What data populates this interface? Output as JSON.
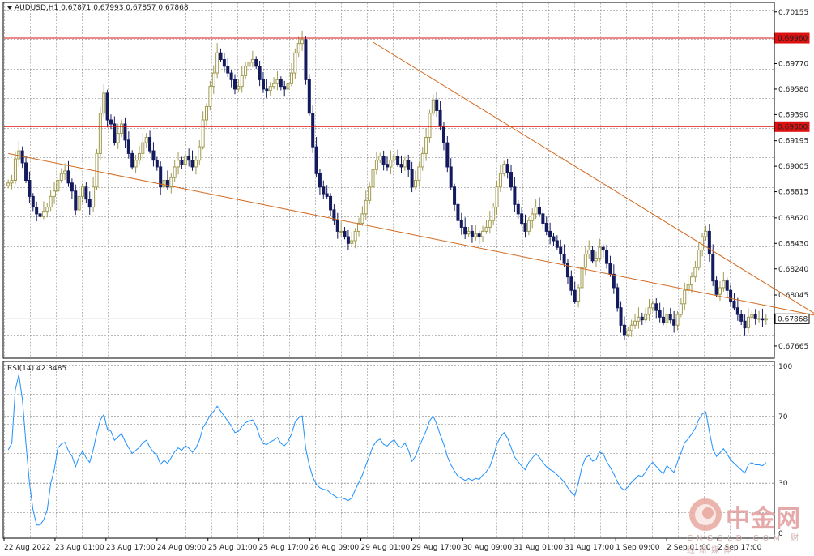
{
  "header": {
    "symbol_line": "AUDUSD,H1  0.67871 0.67993 0.67857 0.67868",
    "menu_icon": "triangle-down-icon"
  },
  "rsi_header": "RSI(14) 42.3485",
  "watermark": {
    "brand": "中金网",
    "url": "CNGOLD.COM",
    "tagline": "财经新媒体"
  },
  "colors": {
    "background": "#ffffff",
    "grid": "#7a7a7a",
    "bull_candle": "#a09a4f",
    "bear_candle": "#141a5e",
    "trend_line": "#d2691e",
    "resistance_line": "#dd1111",
    "current_price_line": "#7a8fb0",
    "rsi_line": "#1e90ff"
  },
  "chart_data": [
    {
      "type": "candlestick",
      "symbol": "AUDUSD",
      "timeframe": "H1",
      "ohlc_header": {
        "open": 0.67871,
        "high": 0.67993,
        "low": 0.67857,
        "close": 0.67868
      },
      "ylim": [
        0.6758,
        0.7022
      ],
      "yticks": [
        "0.70155",
        "0.69770",
        "0.69580",
        "0.69390",
        "0.69195",
        "0.69005",
        "0.68815",
        "0.68620",
        "0.68430",
        "0.68240",
        "0.68045",
        "0.67665"
      ],
      "xticks": [
        "22 Aug 2022",
        "23 Aug 01:00",
        "23 Aug 17:00",
        "24 Aug 09:00",
        "25 Aug 01:00",
        "25 Aug 17:00",
        "26 Aug 09:00",
        "29 Aug 01:00",
        "29 Aug 17:00",
        "30 Aug 09:00",
        "31 Aug 01:00",
        "31 Aug 17:00",
        "1 Sep 09:00",
        "2 Sep 01:00",
        "2 Sep 17:00"
      ],
      "price_levels": [
        {
          "label": "0.69960",
          "value": 0.6996,
          "kind": "horizontal"
        },
        {
          "label": "0.69300",
          "value": 0.693,
          "kind": "horizontal"
        },
        {
          "label": "0.67868",
          "value": 0.67868,
          "kind": "current"
        }
      ],
      "trendlines": [
        {
          "from": [
            0,
            0.691
          ],
          "to": [
            230,
            0.67882
          ]
        },
        {
          "from": [
            103,
            0.6993
          ],
          "to": [
            230,
            0.6787
          ]
        }
      ],
      "closes": [
        0.6888,
        0.689,
        0.6906,
        0.6912,
        0.6903,
        0.689,
        0.6878,
        0.687,
        0.6865,
        0.6863,
        0.6867,
        0.687,
        0.6878,
        0.6882,
        0.689,
        0.6895,
        0.6897,
        0.6888,
        0.6882,
        0.6868,
        0.6878,
        0.6885,
        0.6876,
        0.687,
        0.6885,
        0.691,
        0.694,
        0.6955,
        0.6935,
        0.6932,
        0.6918,
        0.6925,
        0.6932,
        0.692,
        0.691,
        0.69,
        0.6905,
        0.691,
        0.6918,
        0.6922,
        0.6912,
        0.6905,
        0.69,
        0.6885,
        0.689,
        0.6885,
        0.6892,
        0.69,
        0.6905,
        0.6902,
        0.6908,
        0.6905,
        0.69,
        0.6905,
        0.6915,
        0.6935,
        0.6945,
        0.696,
        0.697,
        0.6985,
        0.698,
        0.6975,
        0.697,
        0.6965,
        0.6958,
        0.696,
        0.6968,
        0.6975,
        0.6978,
        0.698,
        0.6975,
        0.6965,
        0.6958,
        0.6957,
        0.696,
        0.6962,
        0.6965,
        0.696,
        0.6958,
        0.6962,
        0.697,
        0.6985,
        0.6992,
        0.6995,
        0.6965,
        0.694,
        0.6915,
        0.6895,
        0.6885,
        0.688,
        0.6878,
        0.6868,
        0.686,
        0.6852,
        0.6852,
        0.6848,
        0.6843,
        0.6845,
        0.6852,
        0.6858,
        0.6865,
        0.6875,
        0.6885,
        0.6898,
        0.6905,
        0.6908,
        0.6902,
        0.69,
        0.6905,
        0.6908,
        0.6902,
        0.69,
        0.6905,
        0.6898,
        0.6885,
        0.689,
        0.69,
        0.691,
        0.6922,
        0.694,
        0.695,
        0.6942,
        0.693,
        0.6918,
        0.69,
        0.6885,
        0.6872,
        0.686,
        0.6855,
        0.685,
        0.6852,
        0.6848,
        0.685,
        0.6848,
        0.6852,
        0.6855,
        0.686,
        0.687,
        0.6885,
        0.6895,
        0.6902,
        0.6896,
        0.6885,
        0.6872,
        0.6865,
        0.6858,
        0.6852,
        0.686,
        0.6865,
        0.687,
        0.6865,
        0.6858,
        0.6852,
        0.6848,
        0.6845,
        0.684,
        0.6835,
        0.6828,
        0.6818,
        0.6808,
        0.68,
        0.681,
        0.6825,
        0.6835,
        0.6838,
        0.683,
        0.6832,
        0.684,
        0.6838,
        0.6828,
        0.682,
        0.681,
        0.6795,
        0.6782,
        0.6775,
        0.6778,
        0.6782,
        0.6785,
        0.6788,
        0.6786,
        0.679,
        0.6795,
        0.6798,
        0.6793,
        0.6788,
        0.6784,
        0.679,
        0.6786,
        0.6782,
        0.679,
        0.6798,
        0.6808,
        0.6812,
        0.6818,
        0.6825,
        0.6838,
        0.6848,
        0.6852,
        0.6835,
        0.6815,
        0.6805,
        0.681,
        0.6815,
        0.6808,
        0.68,
        0.6795,
        0.679,
        0.6785,
        0.678,
        0.6788,
        0.679,
        0.6787,
        0.6787,
        0.6786,
        0.6787
      ],
      "rsi": {
        "label": "RSI(14)",
        "last": 42.3485,
        "ylim": [
          0,
          100
        ],
        "levels": [
          30,
          70
        ],
        "ticks": [
          "100",
          "70",
          "30",
          "0"
        ]
      }
    }
  ]
}
